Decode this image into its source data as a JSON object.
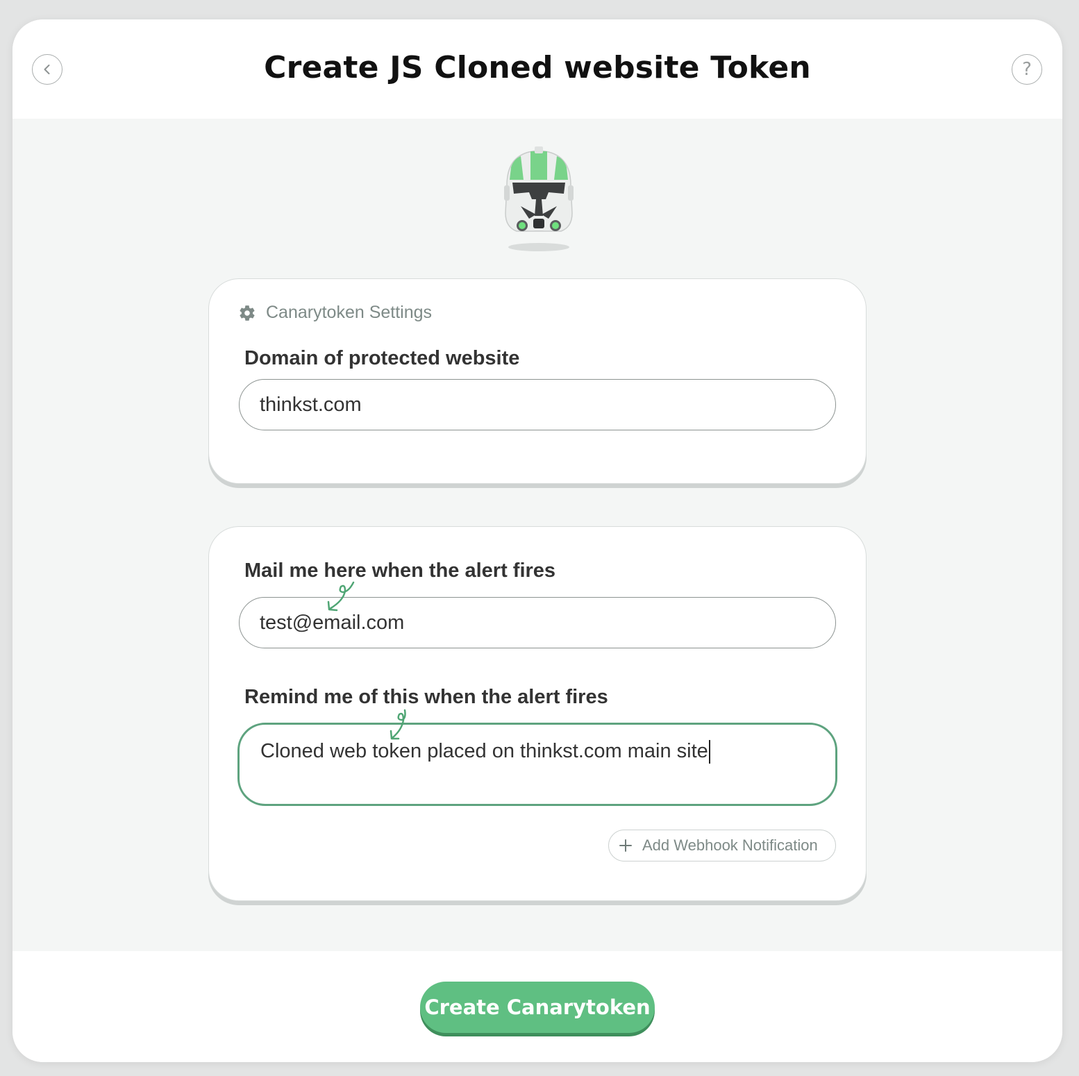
{
  "modal": {
    "title": "Create JS Cloned website Token",
    "back_icon": "chevron-left-icon",
    "help_label": "?"
  },
  "settings_card": {
    "heading": "Canarytoken Settings",
    "heading_icon": "gear-icon",
    "domain_label": "Domain of protected website",
    "domain_value": "thinkst.com"
  },
  "alert_card": {
    "email_label": "Mail me here when the alert fires",
    "email_value": "test@email.com",
    "memo_label": "Remind me of this when the alert fires",
    "memo_value": "Cloned web token placed on thinkst.com main site",
    "webhook_button": "Add Webhook Notification"
  },
  "footer": {
    "create_button": "Create Canarytoken"
  },
  "colors": {
    "accent": "#5fbf82",
    "accent_dark": "#3f8f5c",
    "focus_border": "#5ea37f",
    "body_background": "#f4f6f5"
  }
}
